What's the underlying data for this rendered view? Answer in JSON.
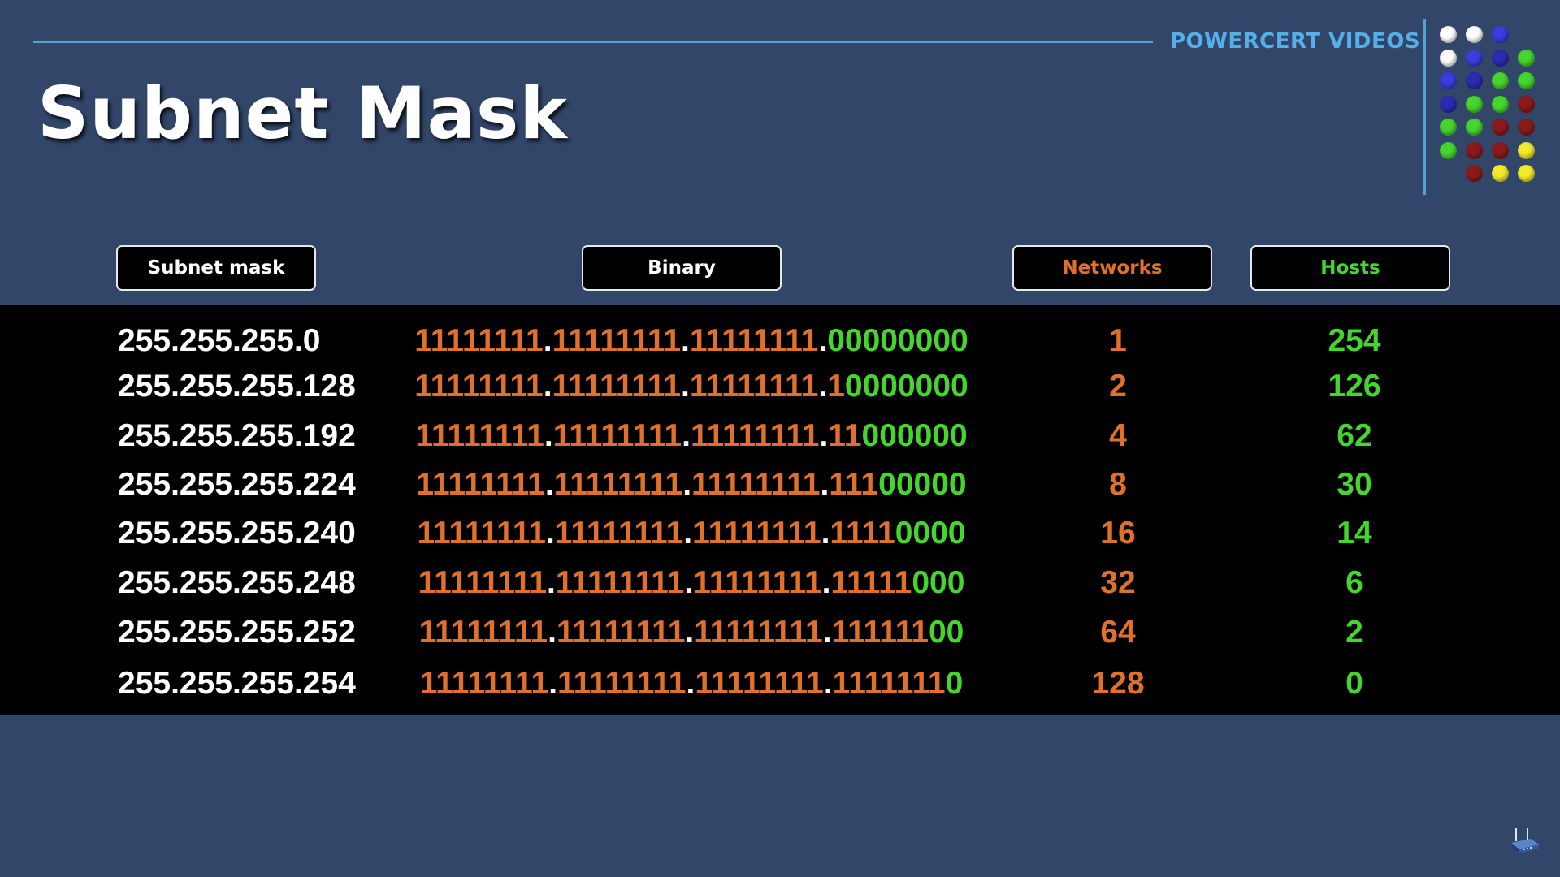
{
  "title": "Subnet Mask",
  "brand": "POWERCERT VIDEOS",
  "headers": {
    "subnet_mask": "Subnet mask",
    "binary": "Binary",
    "networks": "Networks",
    "hosts": "Hosts"
  },
  "rows": [
    {
      "mask": "255.255.255.0",
      "binary_prefix_ones": 24,
      "networks": "1",
      "hosts": "254"
    },
    {
      "mask": "255.255.255.128",
      "binary_prefix_ones": 25,
      "networks": "2",
      "hosts": "126"
    },
    {
      "mask": "255.255.255.192",
      "binary_prefix_ones": 26,
      "networks": "4",
      "hosts": "62"
    },
    {
      "mask": "255.255.255.224",
      "binary_prefix_ones": 27,
      "networks": "8",
      "hosts": "30"
    },
    {
      "mask": "255.255.255.240",
      "binary_prefix_ones": 28,
      "networks": "16",
      "hosts": "14"
    },
    {
      "mask": "255.255.255.248",
      "binary_prefix_ones": 29,
      "networks": "32",
      "hosts": "6"
    },
    {
      "mask": "255.255.255.252",
      "binary_prefix_ones": 30,
      "networks": "64",
      "hosts": "2"
    },
    {
      "mask": "255.255.255.254",
      "binary_prefix_ones": 31,
      "networks": "128",
      "hosts": "0"
    }
  ],
  "colors": {
    "background": "#32466a",
    "table_band": "#000000",
    "ones": "#e0712b",
    "zeros": "#45d62d",
    "accent_line": "#4fa3d8",
    "brand_text": "#55b0ea"
  },
  "logo_dot_colors": [
    [
      "#ffffff",
      "#ffffff",
      "#3b3be0",
      null
    ],
    [
      "#ffffff",
      "#3b3be0",
      "#2b2bb0",
      "#45d62d"
    ],
    [
      "#3b3be0",
      "#2b2bb0",
      "#45d62d",
      "#45d62d"
    ],
    [
      "#2b2bb0",
      "#45d62d",
      "#45d62d",
      "#8b1a1a"
    ],
    [
      "#45d62d",
      "#45d62d",
      "#8b1a1a",
      "#8b1a1a"
    ],
    [
      "#45d62d",
      "#8b1a1a",
      "#8b1a1a",
      "#f2ea2a"
    ],
    [
      null,
      "#8b1a1a",
      "#f2ea2a",
      "#f2ea2a"
    ]
  ],
  "icons": {
    "router": "router-icon"
  }
}
